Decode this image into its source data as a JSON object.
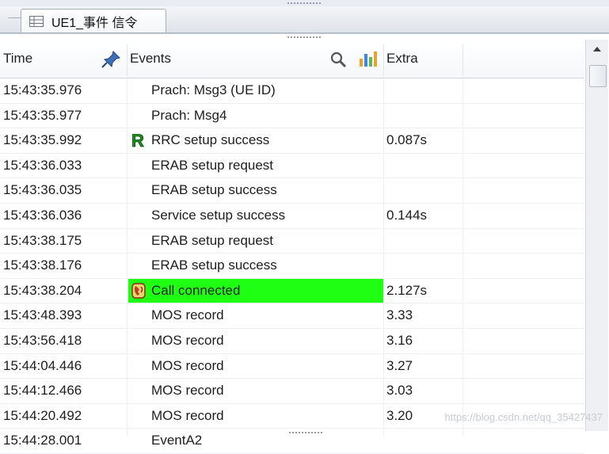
{
  "tab": {
    "label": "UE1_事件 信令",
    "icon": "grid-table-icon"
  },
  "columns": {
    "time": "Time",
    "events": "Events",
    "extra": "Extra"
  },
  "rows": [
    {
      "time": "15:43:35.976",
      "event": "Prach: Msg3 (UE ID)",
      "extra": "",
      "icon": "",
      "highlight": false
    },
    {
      "time": "15:43:35.977",
      "event": "Prach: Msg4",
      "extra": "",
      "icon": "",
      "highlight": false
    },
    {
      "time": "15:43:35.992",
      "event": "RRC setup success",
      "extra": "0.087s",
      "icon": "rrc-r-icon",
      "highlight": false
    },
    {
      "time": "15:43:36.033",
      "event": "ERAB setup request",
      "extra": "",
      "icon": "",
      "highlight": false
    },
    {
      "time": "15:43:36.035",
      "event": "ERAB setup success",
      "extra": "",
      "icon": "",
      "highlight": false
    },
    {
      "time": "15:43:36.036",
      "event": "Service setup success",
      "extra": "0.144s",
      "icon": "",
      "highlight": false
    },
    {
      "time": "15:43:38.175",
      "event": "ERAB setup request",
      "extra": "",
      "icon": "",
      "highlight": false
    },
    {
      "time": "15:43:38.176",
      "event": "ERAB setup success",
      "extra": "",
      "icon": "",
      "highlight": false
    },
    {
      "time": "15:43:38.204",
      "event": "Call connected",
      "extra": "2.127s",
      "icon": "phone-icon",
      "highlight": true
    },
    {
      "time": "15:43:48.393",
      "event": "MOS record",
      "extra": "3.33",
      "icon": "",
      "highlight": false
    },
    {
      "time": "15:43:56.418",
      "event": "MOS record",
      "extra": "3.16",
      "icon": "",
      "highlight": false
    },
    {
      "time": "15:44:04.446",
      "event": "MOS record",
      "extra": "3.27",
      "icon": "",
      "highlight": false
    },
    {
      "time": "15:44:12.466",
      "event": "MOS record",
      "extra": "3.03",
      "icon": "",
      "highlight": false
    },
    {
      "time": "15:44:20.492",
      "event": "MOS record",
      "extra": "3.20",
      "icon": "",
      "highlight": false
    },
    {
      "time": "15:44:28.001",
      "event": "EventA2",
      "extra": "",
      "icon": "",
      "highlight": false
    }
  ],
  "colors": {
    "highlight": "#1fff14",
    "rrc_icon": "#1a8f1a",
    "phone_icon": "#c0392b"
  },
  "watermark": "https://blog.csdn.net/qq_35427437"
}
